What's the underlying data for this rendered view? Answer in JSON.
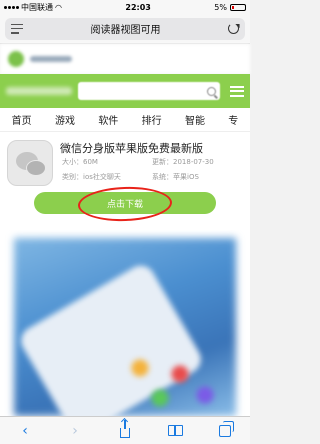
{
  "status_bar": {
    "carrier": "中国联通",
    "time": "22:03",
    "battery": "5%"
  },
  "address_bar": {
    "title": "阅读器视图可用"
  },
  "nav": {
    "items": [
      "首页",
      "游戏",
      "软件",
      "排行",
      "智能",
      "专"
    ]
  },
  "app": {
    "title": "微信分身版苹果版免费最新版",
    "size_label": "大小：",
    "size": "60M",
    "updated_label": "更新：",
    "updated": "2018-07-30",
    "category_label": "类别：",
    "category": "ios社交聊天",
    "system_label": "系统：",
    "system": "苹果iOS",
    "download_label": "点击下载"
  },
  "colors": {
    "accent_green": "#8ccf4d",
    "annotation_red": "#e8231a",
    "ios_blue": "#1a7ae0"
  },
  "toolbar": {
    "icons": [
      "back-icon",
      "forward-icon",
      "share-icon",
      "bookmarks-icon",
      "tabs-icon"
    ]
  }
}
